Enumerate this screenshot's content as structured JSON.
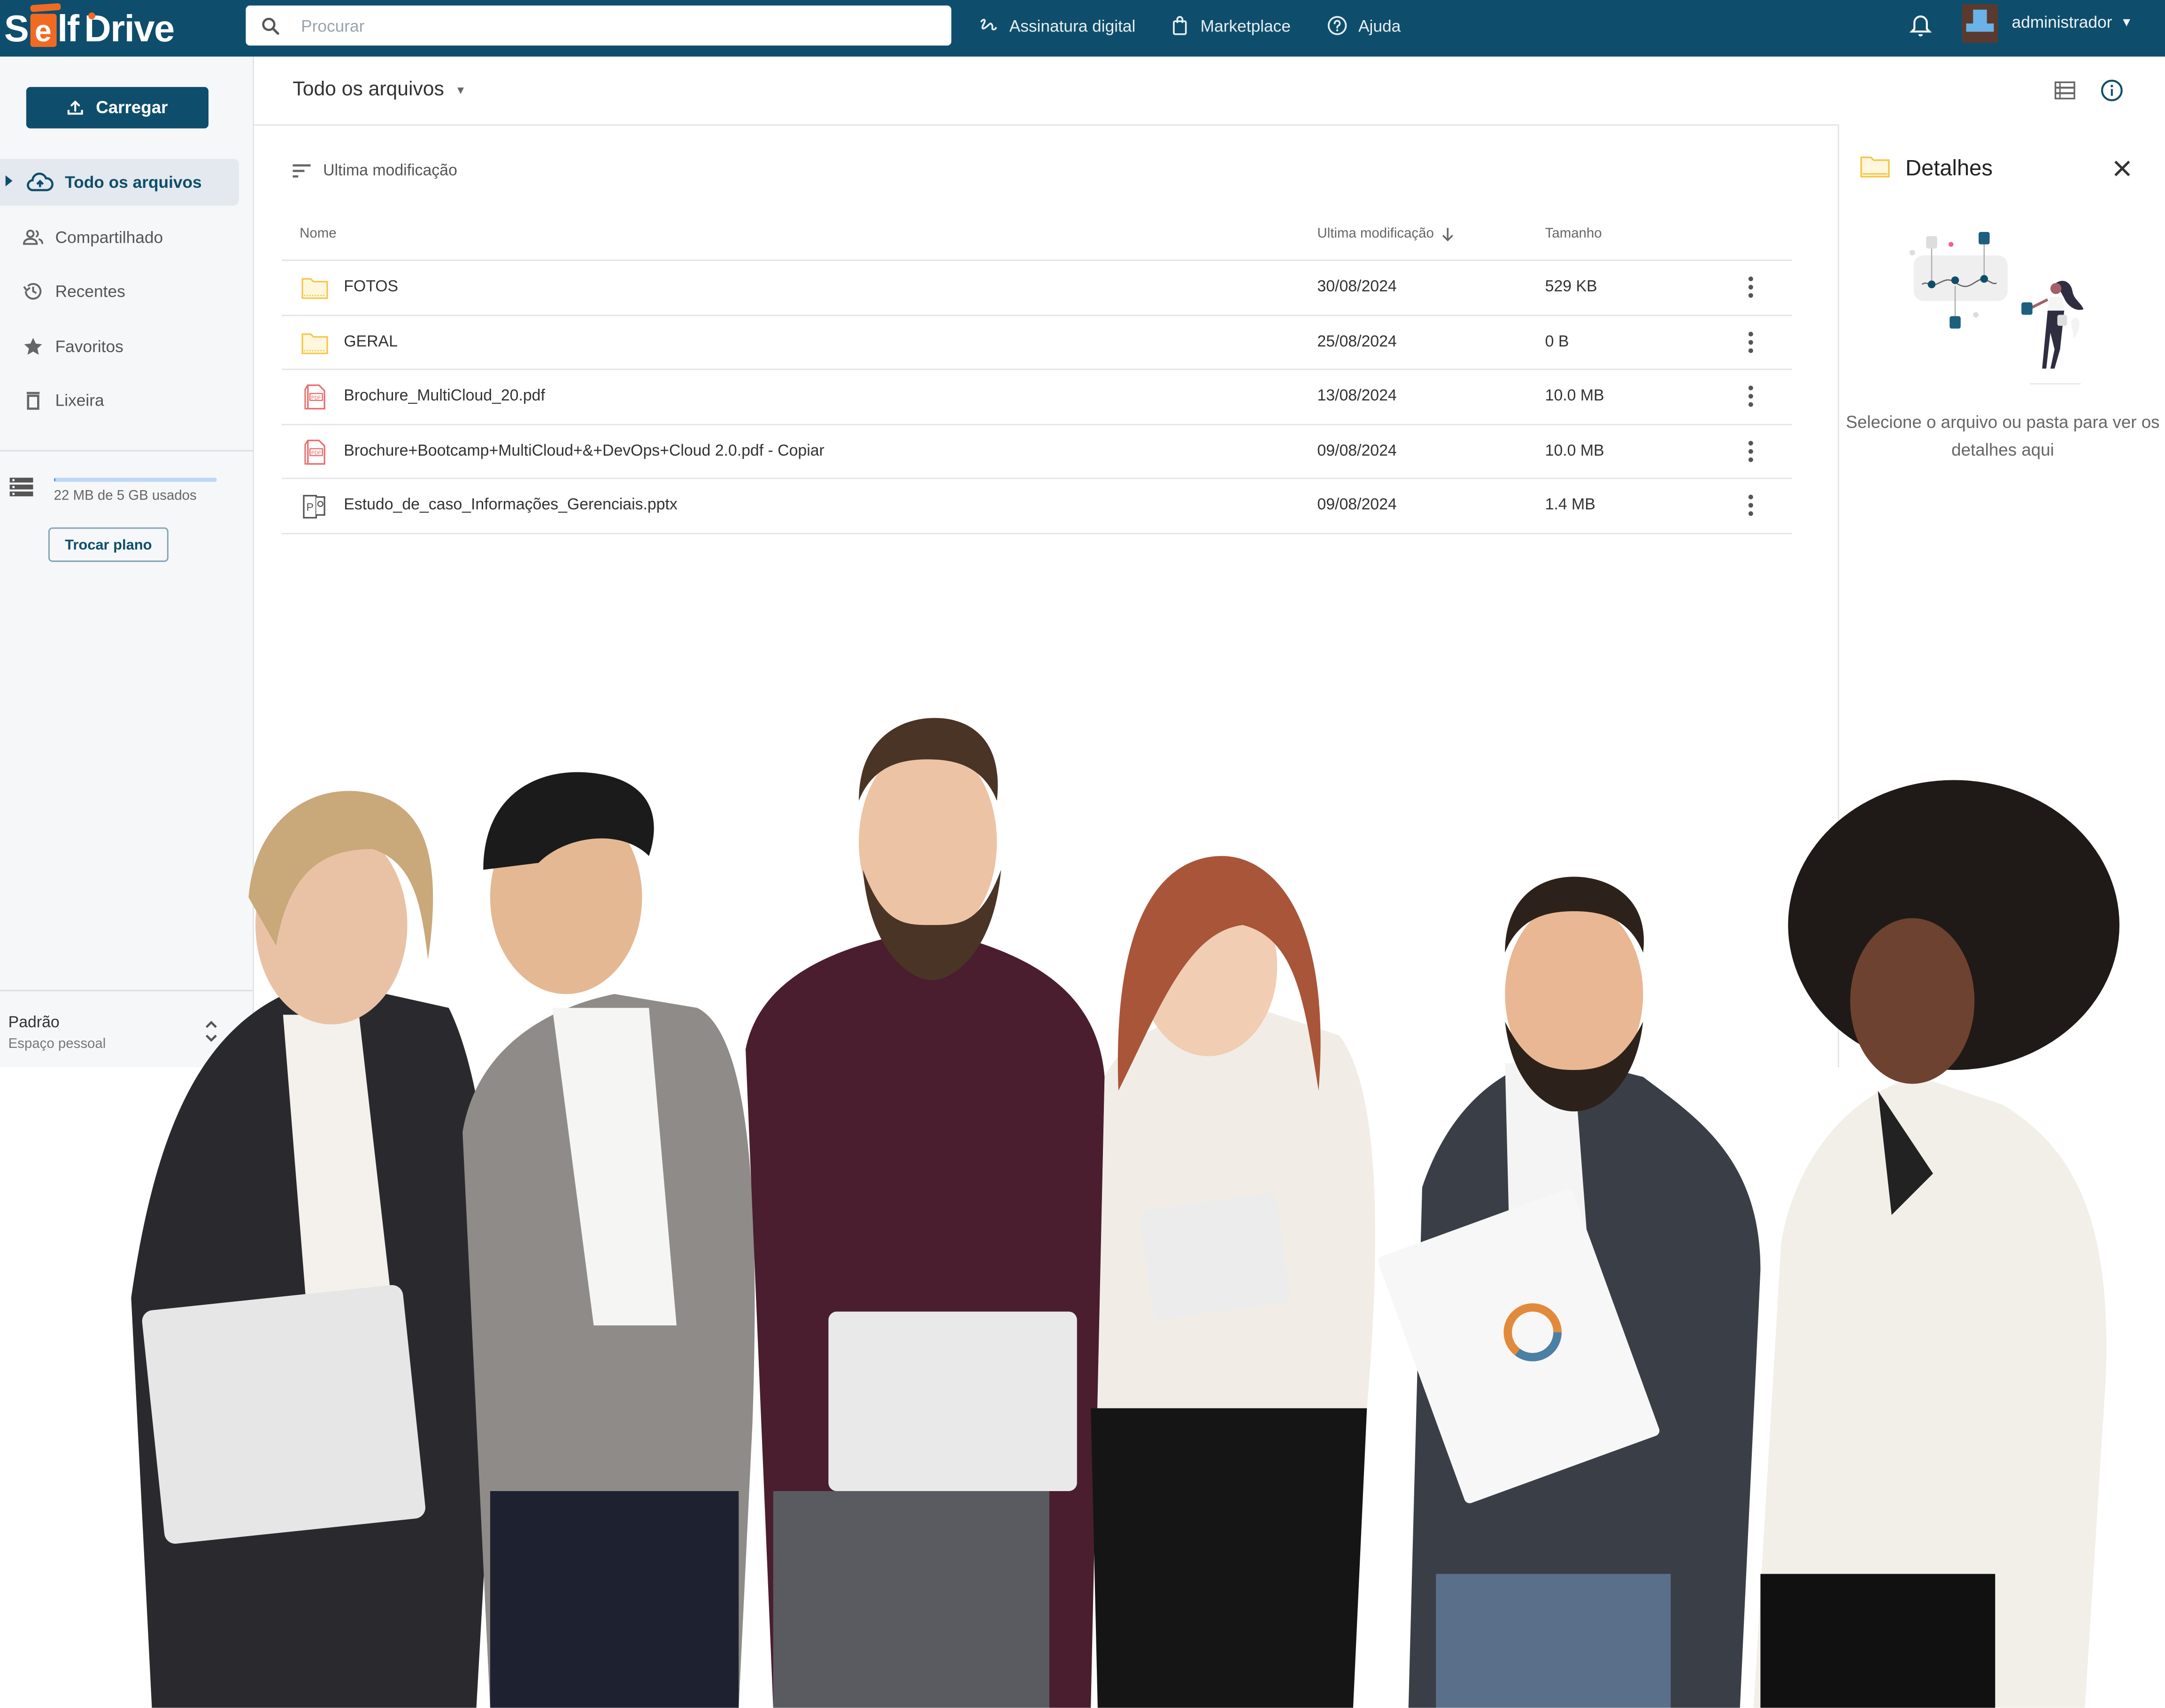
{
  "app": {
    "brand": {
      "part1": "S",
      "part2": "e",
      "part3": "lf",
      "part4": "Drive",
      "accent_color": "#f26a21",
      "bar_color": "#0e4e6c"
    }
  },
  "topbar": {
    "search_placeholder": "Procurar",
    "links": [
      {
        "label": "Assinatura digital",
        "icon": "signature-icon"
      },
      {
        "label": "Marketplace",
        "icon": "shopping-bag-icon"
      },
      {
        "label": "Ajuda",
        "icon": "help-icon"
      }
    ],
    "user": {
      "name": "administrador"
    }
  },
  "sidebar": {
    "upload_label": "Carregar",
    "items": [
      {
        "label": "Todo os arquivos",
        "icon": "cloud-upload-icon",
        "active": true
      },
      {
        "label": "Compartilhado",
        "icon": "people-icon"
      },
      {
        "label": "Recentes",
        "icon": "history-icon"
      },
      {
        "label": "Favoritos",
        "icon": "star-icon"
      },
      {
        "label": "Lixeira",
        "icon": "trash-icon"
      }
    ],
    "storage": {
      "text": "22 MB de 5 GB usados",
      "used_fraction": 0.0043
    },
    "plan_button": "Trocar plano",
    "space": {
      "title": "Padrão",
      "subtitle": "Espaço pessoal"
    }
  },
  "main": {
    "breadcrumb": "Todo os arquivos",
    "sort_label": "Ultima modificação",
    "columns": {
      "name": "Nome",
      "modified": "Ultima modificação",
      "size": "Tamanho"
    },
    "files": [
      {
        "name": "FOTOS",
        "type": "folder",
        "modified": "30/08/2024",
        "size": "529 KB"
      },
      {
        "name": "GERAL",
        "type": "folder",
        "modified": "25/08/2024",
        "size": "0 B"
      },
      {
        "name": "Brochure_MultiCloud_20.pdf",
        "type": "pdf",
        "modified": "13/08/2024",
        "size": "10.0 MB"
      },
      {
        "name": "Brochure+Bootcamp+MultiCloud+&+DevOps+Cloud 2.0.pdf - Copiar",
        "type": "pdf",
        "modified": "09/08/2024",
        "size": "10.0 MB"
      },
      {
        "name": "Estudo_de_caso_Informações_Gerenciais.pptx",
        "type": "pptx",
        "modified": "09/08/2024",
        "size": "1.4 MB"
      }
    ]
  },
  "details": {
    "title": "Detalhes",
    "empty_message": "Selecione o arquivo ou pasta para ver os detalhes aqui"
  },
  "photo": {
    "description": "Group of six smiling business people standing in a row"
  }
}
